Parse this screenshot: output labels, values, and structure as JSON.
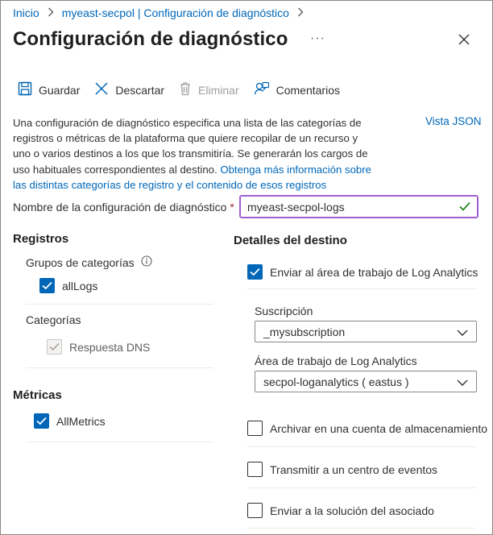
{
  "breadcrumb": {
    "items": [
      "Inicio",
      "myeast-secpol | Configuración de diagnóstico"
    ]
  },
  "header": {
    "title": "Configuración de diagnóstico",
    "more": "···"
  },
  "toolbar": {
    "save_label": "Guardar",
    "discard_label": "Descartar",
    "delete_label": "Eliminar",
    "feedback_label": "Comentarios"
  },
  "description": {
    "text": "Una configuración de diagnóstico especifica una lista de las categorías de registros o métricas de la plataforma que quiere recopilar de un recurso y uno o varios destinos a los que los transmitiría. Se generarán los cargos de uso habituales correspondientes al destino. ",
    "link": "Obtenga más información sobre las distintas categorías de registro y el contenido de esos registros",
    "json_link": "Vista JSON"
  },
  "name_field": {
    "label": "Nombre de la configuración de diagnóstico",
    "required_mark": "*",
    "value": "myeast-secpol-logs"
  },
  "logs": {
    "heading": "Registros",
    "groups_label": "Grupos de categorías",
    "group_item": "allLogs",
    "categories_label": "Categorías",
    "category_item": "Respuesta DNS"
  },
  "metrics": {
    "heading": "Métricas",
    "item": "AllMetrics"
  },
  "destination": {
    "heading": "Detalles del destino",
    "send_log_analytics": "Enviar al área de trabajo de Log Analytics",
    "subscription_label": "Suscripción",
    "subscription_value": "_mysubscription",
    "workspace_label": "Área de trabajo de Log Analytics",
    "workspace_value": "secpol-loganalytics ( eastus )",
    "archive": "Archivar en una cuenta de almacenamiento",
    "stream": "Transmitir a un centro de eventos",
    "partner": "Enviar a la solución del asociado"
  },
  "colors": {
    "accent": "#0067b8",
    "success_check": "#107c10",
    "input_focus": "#a05ed0"
  }
}
